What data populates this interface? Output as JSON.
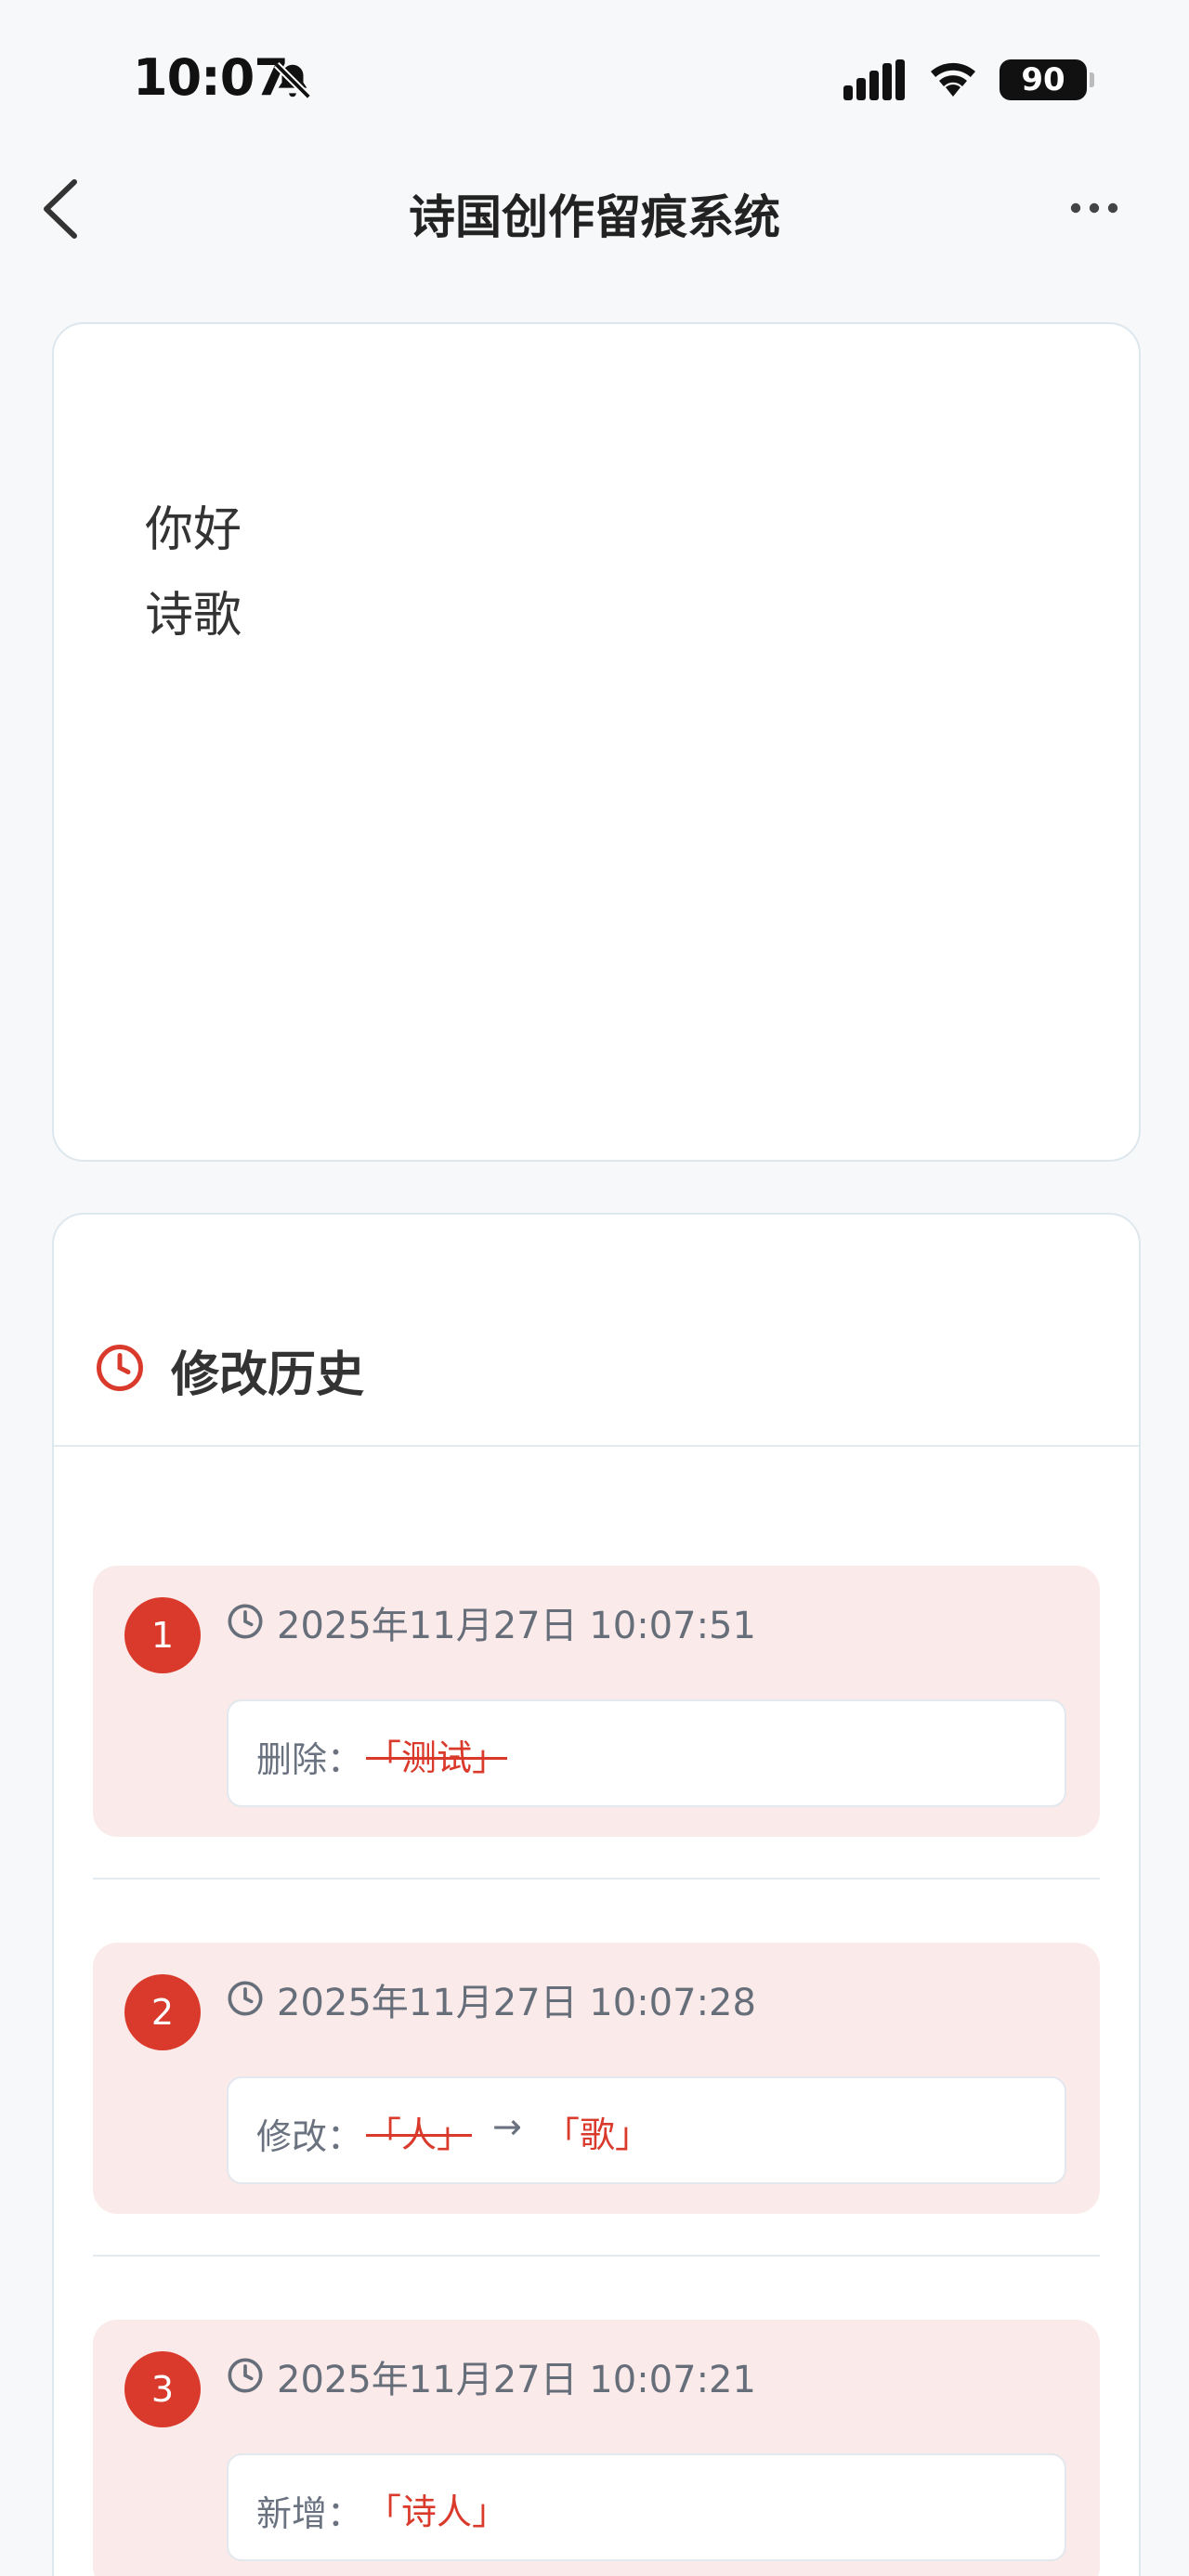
{
  "status_bar": {
    "time": "10:07",
    "battery": "90",
    "icons": [
      "bell-slash-icon",
      "signal-icon",
      "wifi-icon",
      "battery-icon"
    ]
  },
  "nav": {
    "title": "诗国创作留痕系统",
    "back_icon": "chevron-left-icon",
    "more_icon": "more-horizontal-icon"
  },
  "editor": {
    "lines": [
      "你好",
      "诗歌"
    ]
  },
  "history": {
    "title": "修改历史",
    "icon": "clock-icon",
    "accent": "#d93a2b",
    "entries": [
      {
        "index": "1",
        "time": "2025年11月27日 10:07:51",
        "label": "删除：",
        "old": "「测试」"
      },
      {
        "index": "2",
        "time": "2025年11月27日 10:07:28",
        "label": "修改：",
        "old": "「人」",
        "arrow": "→",
        "new": "「歌」"
      },
      {
        "index": "3",
        "time": "2025年11月27日 10:07:21",
        "label": "新增：",
        "new": "「诗人」"
      }
    ]
  }
}
